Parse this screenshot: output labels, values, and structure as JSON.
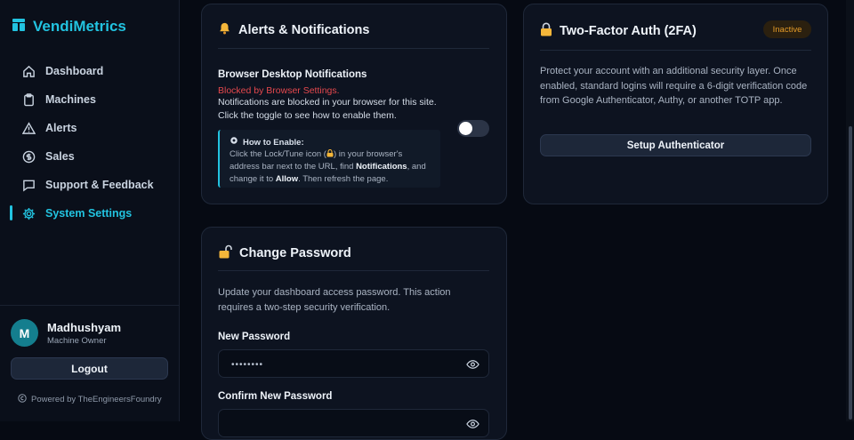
{
  "brand": {
    "name": "VendiMetrics"
  },
  "nav": [
    {
      "label": "Dashboard",
      "icon": "home-icon"
    },
    {
      "label": "Machines",
      "icon": "clipboard-icon"
    },
    {
      "label": "Alerts",
      "icon": "warning-icon"
    },
    {
      "label": "Sales",
      "icon": "dollar-icon"
    },
    {
      "label": "Support & Feedback",
      "icon": "chat-icon"
    },
    {
      "label": "System Settings",
      "icon": "gear-icon",
      "active": true
    }
  ],
  "user": {
    "initial": "M",
    "name": "Madhushyam",
    "role": "Machine Owner"
  },
  "logout_label": "Logout",
  "powered_by": "Powered by TheEngineersFoundry",
  "alerts": {
    "title": "Alerts & Notifications",
    "setting_label": "Browser Desktop Notifications",
    "blocked_text": "Blocked by Browser Settings.",
    "description": "Notifications are blocked in your browser for this site. Click the toggle to see how to enable them.",
    "toggle_on": false,
    "howto_title": "How to Enable:",
    "howto_1": "Click the Lock/Tune icon (",
    "howto_2": ") in your browser's address bar next to the URL, find ",
    "howto_bold1": "Notifications",
    "howto_3": ", and change it to ",
    "howto_bold2": "Allow",
    "howto_4": ". Then refresh the page."
  },
  "twofa": {
    "title": "Two-Factor Auth (2FA)",
    "badge": "Inactive",
    "description": "Protect your account with an additional security layer. Once enabled, standard logins will require a 6-digit verification code from Google Authenticator, Authy, or another TOTP app.",
    "button": "Setup Authenticator"
  },
  "password": {
    "title": "Change Password",
    "description": "Update your dashboard access password. This action requires a two-step security verification.",
    "new_label": "New Password",
    "new_value": "••••••••",
    "confirm_label": "Confirm New Password"
  },
  "colors": {
    "accent": "#22c3e0",
    "warning_text": "#e5484d",
    "badge_text": "#e59b28"
  }
}
